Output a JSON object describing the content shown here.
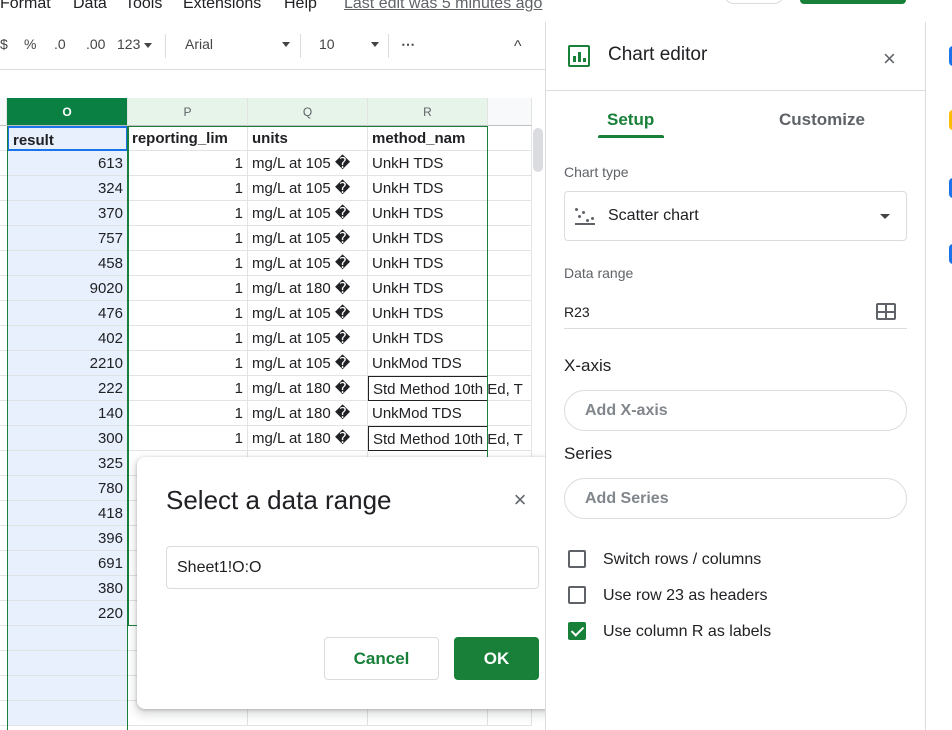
{
  "menubar": {
    "items": [
      "Format",
      "Data",
      "Tools",
      "Extensions",
      "Help"
    ],
    "last_edit": "Last edit was 5 minutes ago"
  },
  "toolbar": {
    "partial": "$",
    "percent": "%",
    "dec_decrease": ".0",
    "dec_increase": ".00",
    "format_123": "123",
    "font": "Arial",
    "font_size": "10",
    "more": "⋯",
    "collapse": "^"
  },
  "sheet": {
    "col_headers": [
      "O",
      "P",
      "Q",
      "R",
      ""
    ],
    "header_row": [
      "result",
      "reporting_lim",
      "units",
      "method_nam"
    ],
    "rows": [
      {
        "result": "613",
        "limit": "1",
        "units": "mg/L at 105 �",
        "method": "UnkH TDS"
      },
      {
        "result": "324",
        "limit": "1",
        "units": "mg/L at 105 �",
        "method": "UnkH TDS"
      },
      {
        "result": "370",
        "limit": "1",
        "units": "mg/L at 105 �",
        "method": "UnkH TDS"
      },
      {
        "result": "757",
        "limit": "1",
        "units": "mg/L at 105 �",
        "method": "UnkH TDS"
      },
      {
        "result": "458",
        "limit": "1",
        "units": "mg/L at 105 �",
        "method": "UnkH TDS"
      },
      {
        "result": "9020",
        "limit": "1",
        "units": "mg/L at 180 �",
        "method": "UnkH TDS"
      },
      {
        "result": "476",
        "limit": "1",
        "units": "mg/L at 105 �",
        "method": "UnkH TDS"
      },
      {
        "result": "402",
        "limit": "1",
        "units": "mg/L at 105 �",
        "method": "UnkH TDS"
      },
      {
        "result": "2210",
        "limit": "1",
        "units": "mg/L at 105 �",
        "method": "UnkMod TDS"
      },
      {
        "result": "222",
        "limit": "1",
        "units": "mg/L at 180 �",
        "method": "Std Method 10th Ed, T"
      },
      {
        "result": "140",
        "limit": "1",
        "units": "mg/L at 180 �",
        "method": "UnkMod TDS"
      },
      {
        "result": "300",
        "limit": "1",
        "units": "mg/L at 180 �",
        "method": "Std Method 10th Ed, T"
      },
      {
        "result": "325",
        "limit": "",
        "units": "",
        "method": ""
      },
      {
        "result": "780",
        "limit": "",
        "units": "",
        "method": ""
      },
      {
        "result": "418",
        "limit": "",
        "units": "",
        "method": ""
      },
      {
        "result": "396",
        "limit": "",
        "units": "",
        "method": ""
      },
      {
        "result": "691",
        "limit": "",
        "units": "",
        "method": ""
      },
      {
        "result": "380",
        "limit": "",
        "units": "",
        "method": ""
      },
      {
        "result": "220",
        "limit": "",
        "units": "",
        "method": ""
      },
      {
        "result": "",
        "limit": "",
        "units": "",
        "method": ""
      },
      {
        "result": "",
        "limit": "",
        "units": "",
        "method": ""
      },
      {
        "result": "",
        "limit": "",
        "units": "",
        "method": ""
      },
      {
        "result": "",
        "limit": "",
        "units": "",
        "method": ""
      }
    ]
  },
  "dialog": {
    "title": "Select a data range",
    "close": "×",
    "range_value": "Sheet1!O:O",
    "cancel": "Cancel",
    "ok": "OK"
  },
  "chart_editor": {
    "title": "Chart editor",
    "close": "×",
    "tabs": [
      "Setup",
      "Customize"
    ],
    "chart_type_label": "Chart type",
    "chart_type_value": "Scatter chart",
    "data_range_label": "Data range",
    "data_range_value": "R23",
    "x_axis_label": "X-axis",
    "x_axis_add": "Add X-axis",
    "series_label": "Series",
    "series_add": "Add Series",
    "checkboxes": [
      {
        "label": "Switch rows / columns",
        "checked": false
      },
      {
        "label": "Use row 23 as headers",
        "checked": false
      },
      {
        "label": "Use column R as labels",
        "checked": true
      }
    ]
  },
  "colors": {
    "accent_green": "#188038",
    "selected_column": "#e8f0fe",
    "selected_header": "#0b8043"
  }
}
